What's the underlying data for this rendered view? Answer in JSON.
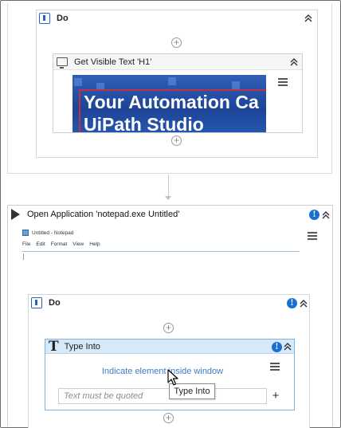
{
  "do_top": {
    "title": "Do",
    "activity": {
      "title": "Get Visible Text 'H1'",
      "screenshot": {
        "line1": "Your Automation Ca",
        "line2": "UiPath Studio"
      }
    }
  },
  "open_application": {
    "title": "Open Application 'notepad.exe Untitled'",
    "notepad": {
      "window_title": "Untitled - Notepad",
      "menu": [
        "File",
        "Edit",
        "Format",
        "View",
        "Help"
      ]
    },
    "do": {
      "title": "Do",
      "type_into": {
        "title": "Type Into",
        "indicate_link": "Indicate element inside window",
        "text_placeholder": "Text must be quoted",
        "plus_label": "+"
      }
    }
  },
  "tooltip": "Type Into",
  "icons": {
    "sequence": "sequence-icon",
    "monitor": "monitor-icon",
    "play": "play-icon",
    "type": "type-into-icon",
    "info": "info-icon",
    "collapse": "collapse-icon",
    "menu": "hamburger-icon",
    "add": "add-circle-icon"
  },
  "colors": {
    "accent": "#1a6fd0",
    "link": "#3b7cc4",
    "selected_header": "#d6e9f9",
    "selected_border": "#7ab4e8",
    "highlight_box": "#c03040"
  }
}
